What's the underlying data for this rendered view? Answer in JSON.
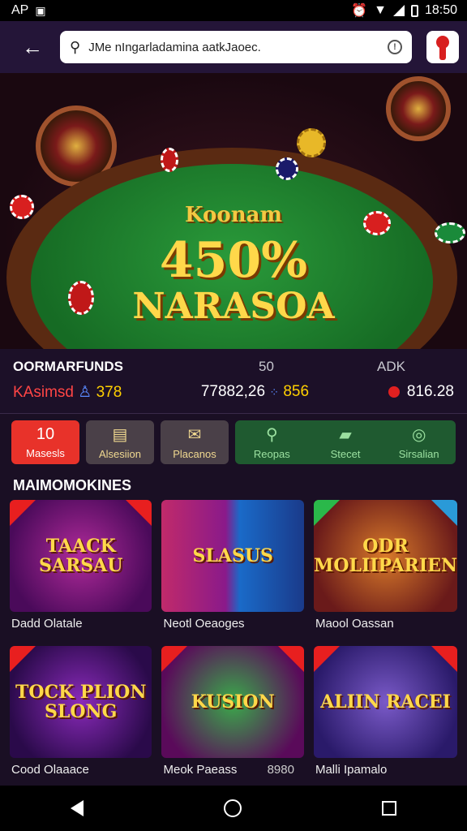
{
  "status": {
    "left": "AP",
    "time": "18:50"
  },
  "search": {
    "value": "JMe nIngarladamina aatkJaoec."
  },
  "hero": {
    "brand": "Koonam",
    "percent": "450%",
    "title": "NARASOA"
  },
  "stats": {
    "header": "OORMARFUNDS",
    "col2": "50",
    "col3": "ADK",
    "casino": "KAsimsd",
    "v1": "378",
    "v2": "77882,26",
    "v3": "856",
    "v4": "816.28"
  },
  "quick_actions": [
    {
      "label": "Masesls",
      "icon": "10"
    },
    {
      "label": "Alsesiion"
    },
    {
      "label": "Placanos"
    },
    {
      "label": "Reopas"
    },
    {
      "label": "Stecet"
    },
    {
      "label": "Sirsalian"
    }
  ],
  "section": {
    "title": "MAIMOMOKINES"
  },
  "games": [
    {
      "name": "TAACK SARSAU",
      "label": "Dadd Olatale",
      "extra": ""
    },
    {
      "name": "SLASUS",
      "label": "Neotl Oeaoges",
      "extra": ""
    },
    {
      "name": "ODR MOLIIPARIEN",
      "label": "Maool Oassan",
      "extra": ""
    },
    {
      "name": "TOCK PLION SLONG",
      "label": "Cood Olaaace",
      "extra": ""
    },
    {
      "name": "KUSION",
      "label": "Meok Paeass",
      "extra": "8980"
    },
    {
      "name": "ALIIN RACEI",
      "label": "Malli Ipamalo",
      "extra": ""
    }
  ]
}
